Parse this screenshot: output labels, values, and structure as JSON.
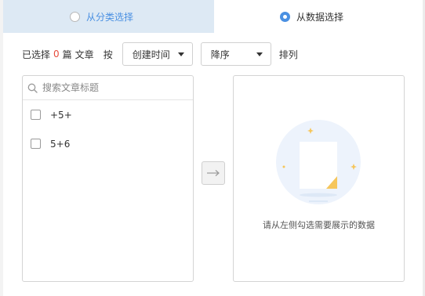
{
  "tabs": {
    "category": {
      "label": "从分类选择",
      "selected": false
    },
    "data": {
      "label": "从数据选择",
      "selected": true
    }
  },
  "toolbar": {
    "selected_prefix": "已选择",
    "selected_count": "0",
    "unit": "篇",
    "item_word": "文章",
    "by_label": "按",
    "sort_field": "创建时间",
    "sort_order": "降序",
    "sort_label": "排列"
  },
  "left_panel": {
    "search_placeholder": "搜索文章标题",
    "items": [
      {
        "label": "+5+",
        "checked": false
      },
      {
        "label": "5+6",
        "checked": false
      }
    ]
  },
  "right_panel": {
    "empty_text": "请从左侧勾选需要展示的数据"
  },
  "colors": {
    "accent": "#4a90e2",
    "count": "#e74c3c",
    "tab_active_bg": "#dde9f4"
  },
  "icons": {
    "search": "search-icon",
    "transfer": "arrow-right-icon",
    "empty": "empty-document-icon"
  }
}
